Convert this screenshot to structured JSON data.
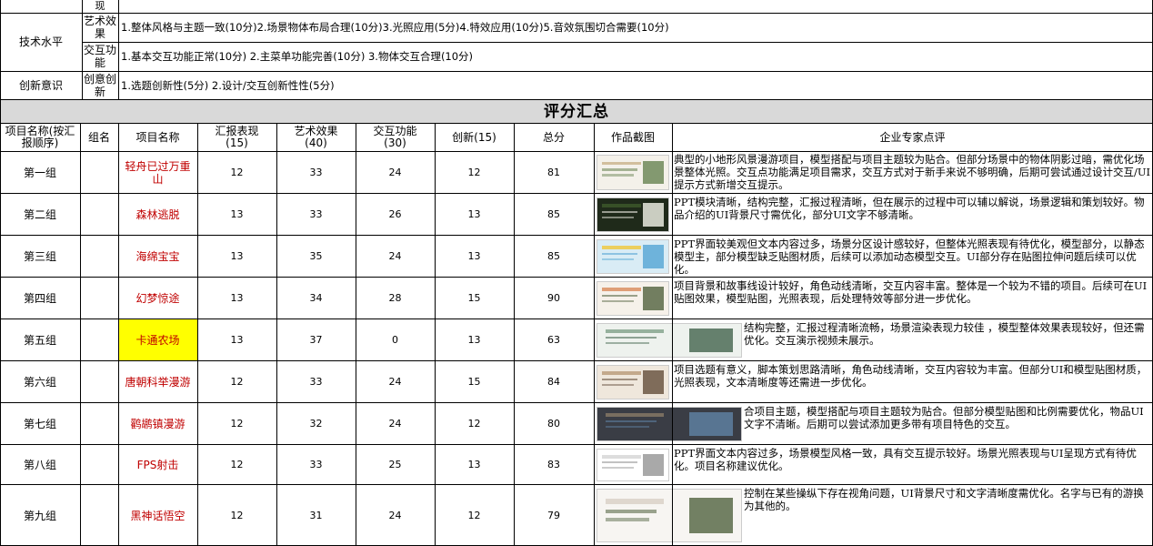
{
  "criteria": {
    "top_partial_label": "现",
    "rows": [
      {
        "category": "技术水平",
        "sub": "艺术效果",
        "desc": "1.整体风格与主题一致(10分)2.场景物体布局合理(10分)3.光照应用(5分)4.特效应用(10分)5.音效氛围切合需要(10分)"
      },
      {
        "category": "",
        "sub": "交互功能",
        "desc": "1.基本交互功能正常(10分) 2.主菜单功能完善(10分) 3.物体交互合理(10分)"
      },
      {
        "category": "创新意识",
        "sub": "创意创新",
        "desc": "1.选题创新性(5分) 2.设计/交互创新性性(5分)"
      }
    ]
  },
  "summary_title": "评分汇总",
  "columns": [
    "项目名称(按汇报顺序)",
    "组名",
    "项目名称",
    "汇报表现\n(15)",
    "艺术效果\n(40)",
    "交互功能\n(30)",
    "创新(15)",
    "总分",
    "作品截图",
    "企业专家点评"
  ],
  "rows": [
    {
      "order": "第一组",
      "group": "",
      "project": "轻舟已过万重山",
      "report": 12,
      "art": 33,
      "interact": 24,
      "innov": 12,
      "total": 81,
      "comment": "典型的小地形风景漫游项目，模型搭配与项目主题较为贴合。但部分场景中的物体阴影过暗，需优化场景整体光照。交互点功能满足项目需求，交互方式对于新手来说不够明确，后期可尝试通过设计交互/UI提示方式新增交互提示。"
    },
    {
      "order": "第二组",
      "group": "",
      "project": "森林逃脱",
      "report": 13,
      "art": 33,
      "interact": 26,
      "innov": 13,
      "total": 85,
      "comment": "PPT模块清晰，结构完整，汇报过程清晰，但在展示的过程中可以辅以解说，场景逻辑和策划较好。物品介绍的UI背景尺寸需优化，部分UI文字不够清晰。"
    },
    {
      "order": "第三组",
      "group": "",
      "project": "海绵宝宝",
      "report": 13,
      "art": 35,
      "interact": 24,
      "innov": 13,
      "total": 85,
      "comment": "PPT界面较美观但文本内容过多，场景分区设计感较好，但整体光照表现有待优化，模型部分，以静态模型主，部分模型缺乏贴图材质，后续可以添加动态模型交互。UI部分存在贴图拉伸问题后续可以优化。"
    },
    {
      "order": "第四组",
      "group": "",
      "project": "幻梦惊途",
      "report": 13,
      "art": 34,
      "interact": 28,
      "innov": 15,
      "total": 90,
      "comment": "项目背景和故事线设计较好，角色动线清晰，交互内容丰富。整体是一个较为不错的项目。后续可在UI贴图效果，模型贴图，光照表现，后处理特效等部分进一步优化。"
    },
    {
      "order": "第五组",
      "group": "",
      "project": "卡通农场",
      "report": 13,
      "art": 37,
      "interact": 0,
      "innov": 13,
      "total": 63,
      "comment": "结构完整，汇报过程清晰流畅，场景渲染表现力较佳 ，模型整体效果表现较好，但还需优化。交互演示视频未展示。"
    },
    {
      "order": "第六组",
      "group": "",
      "project": "唐朝科举漫游",
      "report": 12,
      "art": 33,
      "interact": 24,
      "innov": 15,
      "total": 84,
      "comment": "项目选题有意义，脚本策划思路清晰，角色动线清晰，交互内容较为丰富。但部分UI和模型贴图材质，光照表现，文本清晰度等还需进一步优化。"
    },
    {
      "order": "第七组",
      "group": "",
      "project": "鹳鹕镇漫游",
      "report": 12,
      "art": 32,
      "interact": 24,
      "innov": 12,
      "total": 80,
      "comment": "合项目主题，模型搭配与项目主题较为贴合。但部分模型贴图和比例需要优化，物品UI文字不清晰。后期可以尝试添加更多带有项目特色的交互。"
    },
    {
      "order": "第八组",
      "group": "",
      "project": "FPS射击",
      "report": 12,
      "art": 33,
      "interact": 25,
      "innov": 13,
      "total": 83,
      "comment": "PPT界面文本内容过多，场景模型风格一致，具有交互提示较好。场景光照表现与UI呈现方式有待优化。项目名称建议优化。"
    },
    {
      "order": "第九组",
      "group": "",
      "project": "黑神话悟空",
      "report": 12,
      "art": 31,
      "interact": 24,
      "innov": 12,
      "total": 79,
      "comment": "控制在某些操纵下存在视角问题，UI背景尺寸和文字清晰度需优化。名字与已有的游换为其他的。"
    }
  ],
  "colors": {
    "project_red": "#c00000",
    "highlight": "#ffff00",
    "header_gray": "#d9d9d9"
  }
}
